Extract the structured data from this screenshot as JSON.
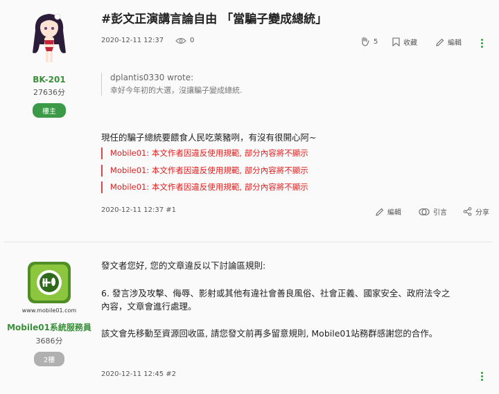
{
  "post1": {
    "title": "#彭文正演講言論自由 「當騙子變成總統」",
    "author": {
      "name": "BK-201",
      "score": "27636分",
      "badge": "樓主"
    },
    "date": "2020-12-11 12:37",
    "views": "0",
    "likes": "5",
    "actions": {
      "favorite": "收藏",
      "edit": "編輯"
    },
    "quote": {
      "who": "dplantis0330 wrote:",
      "text": "幸好今年初的大選，沒讓騙子變成總統."
    },
    "body": "現任的騙子總統要餵食人民吃萊豬咧，有沒有很開心阿~",
    "notices": [
      "Mobile01: 本文作者因違反使用規範, 部分內容將不顯示",
      "Mobile01: 本文作者因違反使用規範, 部分內容將不顯示",
      "Mobile01: 本文作者因違反使用規範, 部分內容將不顯示"
    ],
    "footer": {
      "stamp": "2020-12-11 12:37 #1",
      "edit": "編輯",
      "quote": "引言",
      "share": "分享"
    }
  },
  "post2": {
    "author": {
      "name": "Mobile01系統服務員",
      "score": "3686分",
      "badge": "2樓",
      "logo_url_text": "www.mobile01.com"
    },
    "paragraphs": [
      "發文者您好, 您的文章違反以下討論區規則:",
      "6. 發言涉及攻擊、侮辱、影射或其他有違社會善良風俗、社會正義、國家安全、政府法令之",
      "內容，文章會進行處理。",
      "該文會先移動至資源回收區, 請您發文前再多留意規則, Mobile01站務群感謝您的合作。"
    ],
    "footer": {
      "stamp": "2020-12-11 12:45 #2"
    }
  },
  "colors": {
    "accent": "#3a9a47",
    "notice": "#e02020"
  },
  "icons": [
    "eye-icon",
    "clap-icon",
    "bookmark-icon",
    "pencil-icon",
    "more-icon",
    "quote-icon",
    "share-icon"
  ]
}
